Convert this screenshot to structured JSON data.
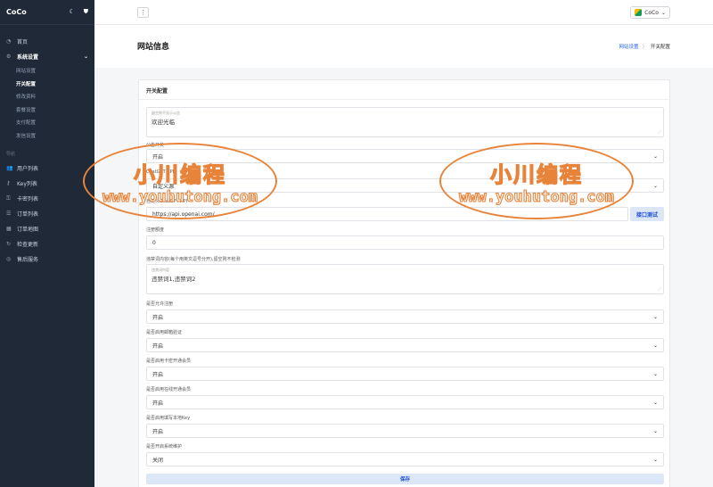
{
  "brand": {
    "name": "CoCo",
    "theme_icon": "moon-icon",
    "shield_icon": "shield-icon"
  },
  "sidebar": {
    "home": "首页",
    "settings": "系统设置",
    "settings_sub": [
      "网站设置",
      "开关配置",
      "修改资料",
      "套餐设置",
      "支付配置",
      "发信设置"
    ],
    "section": "导航",
    "nav": [
      "用户列表",
      "Key列表",
      "卡密列表",
      "订单列表",
      "订单地图",
      "检查更新",
      "售后服务"
    ]
  },
  "topbar": {
    "menu_glyph": "⋮",
    "user": "CoCo"
  },
  "page": {
    "title": "网站信息"
  },
  "breadcrumb": {
    "link": "网站设置",
    "sep": "〉",
    "current": "开关配置"
  },
  "card": {
    "title": "开关配置",
    "notice_placeholder": "留空则不显示公告",
    "notice_value": "欢迎光临",
    "announce_label": "公告开关",
    "announce_value": "开启",
    "gpt_api_label": "ChatGPT API",
    "gpt_api_value": "自定义源",
    "custom_api_label": "自定义ChatGPT API",
    "custom_api_value": "https://api.openai.com/",
    "api_test_btn": "接口测试",
    "quota_label": "注册额度",
    "quota_value": "0",
    "banned_label": "违禁词内容(每个用英文逗号分开),留空则不检测",
    "banned_placeholder": "违禁词内容",
    "banned_value": "违禁词1,违禁词2",
    "allow_reg_label": "是否允许注册",
    "allow_reg_value": "开启",
    "email_verify_label": "是否启用邮箱验证",
    "email_verify_value": "开启",
    "card_member_label": "是否启用卡密开通会员",
    "card_member_value": "开启",
    "online_member_label": "是否启用在线开通会员",
    "online_member_value": "开启",
    "local_key_label": "是否启用填写本地Key",
    "local_key_value": "开启",
    "maintenance_label": "是否开启系统维护",
    "maintenance_value": "关闭",
    "save_btn": "保存"
  },
  "watermark": {
    "cn": "小川编程",
    "url": "www.youhutong.com"
  }
}
